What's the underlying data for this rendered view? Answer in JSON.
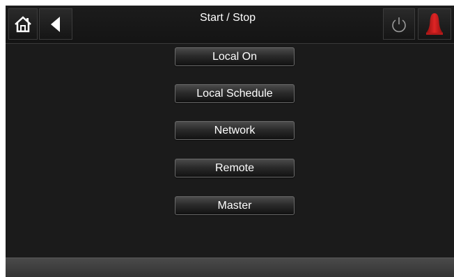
{
  "header": {
    "title": "Start / Stop",
    "icons": {
      "home": "home-icon",
      "back": "back-arrow-icon",
      "power": "power-icon",
      "alarm": "alarm-bell-icon"
    }
  },
  "menu": {
    "items": [
      {
        "label": "Local On"
      },
      {
        "label": "Local Schedule"
      },
      {
        "label": "Network"
      },
      {
        "label": "Remote"
      },
      {
        "label": "Master"
      }
    ]
  },
  "colors": {
    "background": "#1b1b1b",
    "button_text": "#ffffff",
    "alarm": "#cc1a1a",
    "footer": "#3d3d3d"
  }
}
